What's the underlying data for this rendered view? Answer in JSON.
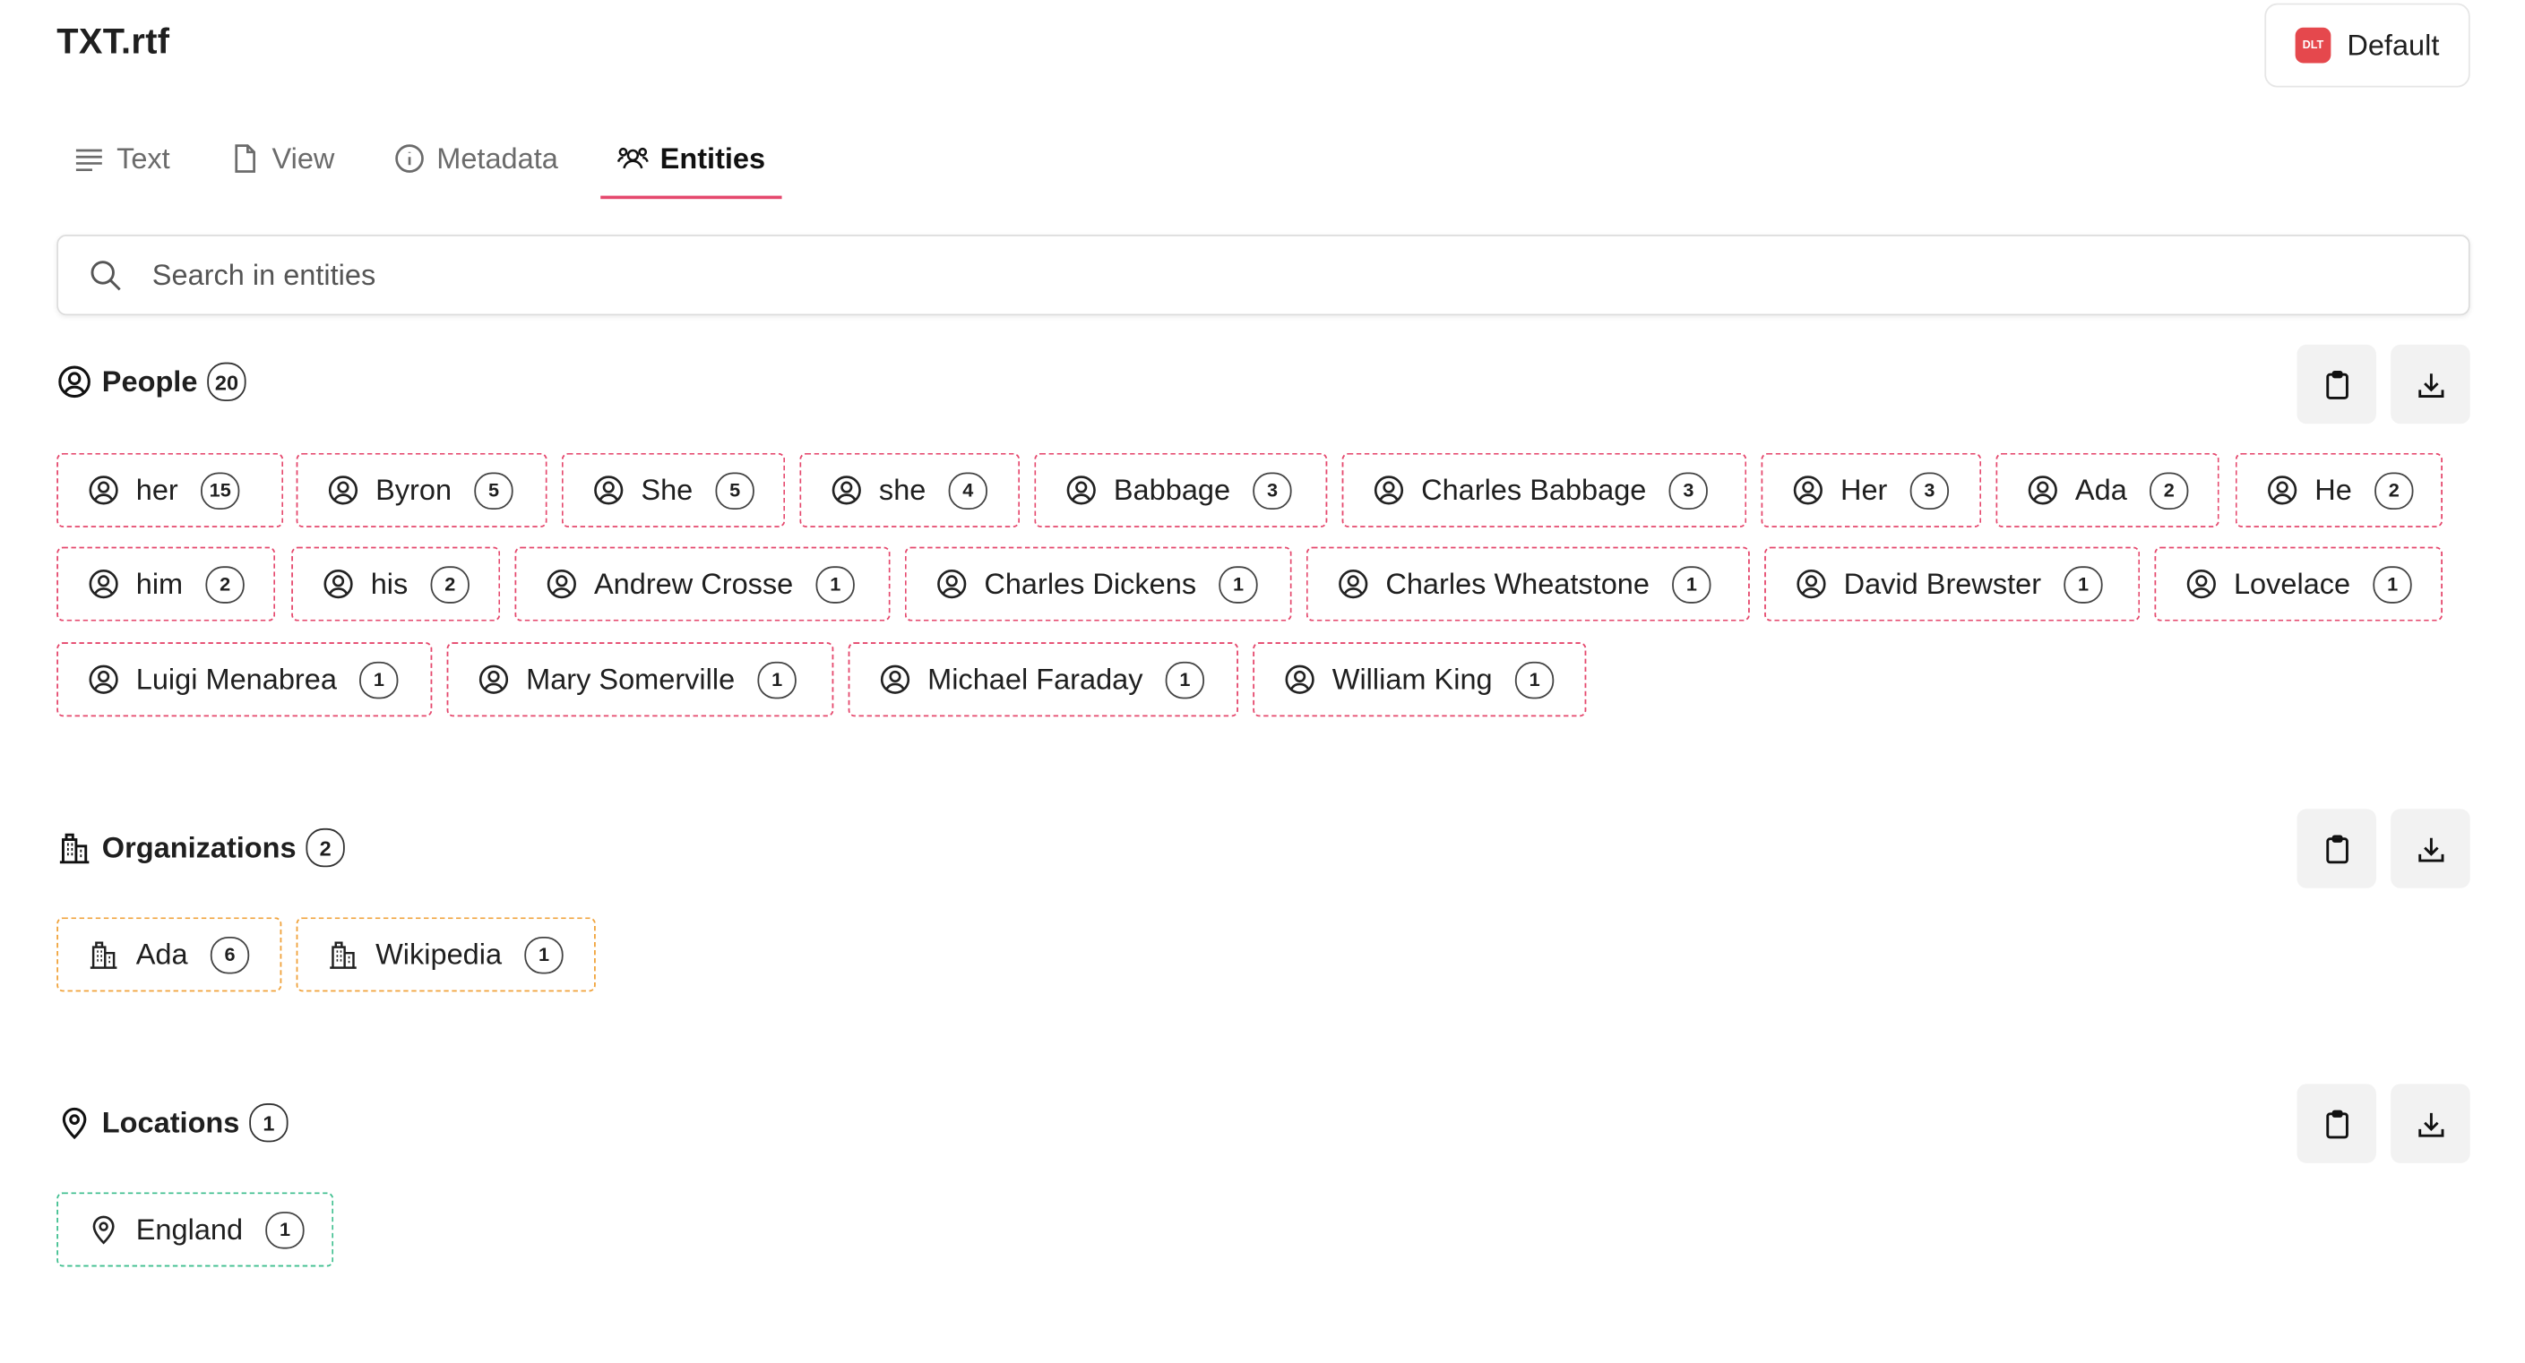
{
  "header": {
    "title": "TXT.rtf",
    "profile_badge": "DLT",
    "profile_label": "Default"
  },
  "tabs": [
    {
      "label": "Text",
      "icon": "text-lines-icon",
      "active": false
    },
    {
      "label": "View",
      "icon": "document-icon",
      "active": false
    },
    {
      "label": "Metadata",
      "icon": "info-icon",
      "active": false
    },
    {
      "label": "Entities",
      "icon": "users-icon",
      "active": true
    }
  ],
  "search": {
    "placeholder": "Search in entities",
    "value": ""
  },
  "colors": {
    "accent": "#e5486d",
    "people_border": "#e5486d",
    "org_border": "#f0a23a",
    "loc_border": "#3fbf8f",
    "badge_red": "#e5484d"
  },
  "sections": {
    "people": {
      "title": "People",
      "count": "20",
      "icon": "user-circle-icon",
      "items": [
        {
          "label": "her",
          "count": "15"
        },
        {
          "label": "Byron",
          "count": "5"
        },
        {
          "label": "She",
          "count": "5"
        },
        {
          "label": "she",
          "count": "4"
        },
        {
          "label": "Babbage",
          "count": "3"
        },
        {
          "label": "Charles Babbage",
          "count": "3"
        },
        {
          "label": "Her",
          "count": "3"
        },
        {
          "label": "Ada",
          "count": "2"
        },
        {
          "label": "He",
          "count": "2"
        },
        {
          "label": "him",
          "count": "2"
        },
        {
          "label": "his",
          "count": "2"
        },
        {
          "label": "Andrew Crosse",
          "count": "1"
        },
        {
          "label": "Charles Dickens",
          "count": "1"
        },
        {
          "label": "Charles Wheatstone",
          "count": "1"
        },
        {
          "label": "David Brewster",
          "count": "1"
        },
        {
          "label": "Lovelace",
          "count": "1"
        },
        {
          "label": "Luigi Menabrea",
          "count": "1"
        },
        {
          "label": "Mary Somerville",
          "count": "1"
        },
        {
          "label": "Michael Faraday",
          "count": "1"
        },
        {
          "label": "William King",
          "count": "1"
        }
      ]
    },
    "organizations": {
      "title": "Organizations",
      "count": "2",
      "icon": "building-icon",
      "items": [
        {
          "label": "Ada",
          "count": "6"
        },
        {
          "label": "Wikipedia",
          "count": "1"
        }
      ]
    },
    "locations": {
      "title": "Locations",
      "count": "1",
      "icon": "map-pin-icon",
      "items": [
        {
          "label": "England",
          "count": "1"
        }
      ]
    }
  },
  "actions": {
    "copy_icon": "clipboard-icon",
    "download_icon": "download-icon"
  }
}
